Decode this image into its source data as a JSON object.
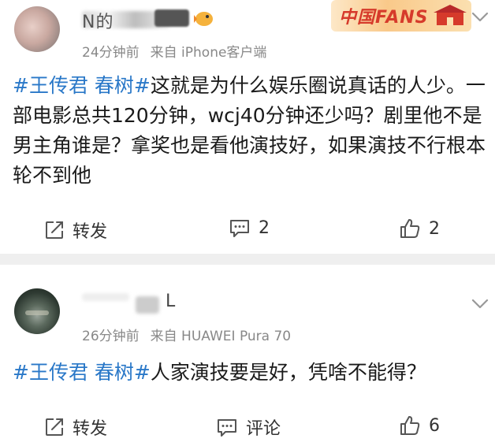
{
  "colors": {
    "hashtag": "#2a78c8",
    "meta": "#888888",
    "text": "#1a1a1a",
    "separator": "#efefef",
    "badge_text": "#d63a2b"
  },
  "posts": [
    {
      "username_visible": "N的",
      "time": "24分钟前",
      "source": "来自 iPhone客户端",
      "badge": "中国FANS",
      "content": {
        "tag": "#王传君 春树#",
        "text": "这就是为什么娱乐圈说真话的人少。一部电影总共120分钟，wcj40分钟还少吗？剧里他不是男主角谁是？拿奖也是看他演技好，如果演技不行根本轮不到他"
      },
      "actions": {
        "repost": "转发",
        "comment": "2",
        "like": "2"
      }
    },
    {
      "username_visible": "L",
      "time": "26分钟前",
      "source": "来自 HUAWEI Pura 70",
      "content": {
        "tag": "#王传君 春树#",
        "text": "人家演技要是好，凭啥不能得？"
      },
      "actions": {
        "repost": "转发",
        "comment": "评论",
        "like": "6"
      }
    }
  ]
}
